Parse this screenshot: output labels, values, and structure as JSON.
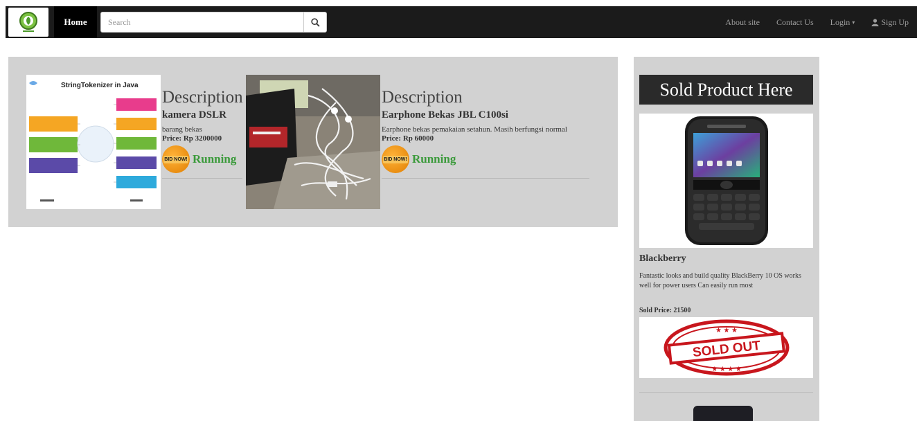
{
  "navbar": {
    "home_label": "Home",
    "search_placeholder": "Search",
    "about_label": "About site",
    "contact_label": "Contact Us",
    "login_label": "Login",
    "signup_label": "Sign Up"
  },
  "products": [
    {
      "image_title": "StringTokenizer in Java",
      "heading": "Description",
      "name": "kamera DSLR",
      "description": "barang bekas",
      "price": "Price: Rp 3200000",
      "bid_label": "BID NOW!",
      "status": "Running"
    },
    {
      "heading": "Description",
      "name": "Earphone Bekas JBL C100si",
      "description": "Earphone bekas pemakaian setahun. Masih berfungsi normal",
      "price": "Price: Rp 60000",
      "bid_label": "BID NOW!",
      "status": "Running"
    }
  ],
  "sidebar": {
    "header": "Sold Product Here",
    "item": {
      "name": "Blackberry",
      "description": "Fantastic looks and build quality BlackBerry 10 OS works well for power users Can easily run most",
      "price": "Sold Price: 21500",
      "stamp_text": "SOLD OUT"
    }
  },
  "colors": {
    "navbar_bg": "#1b1b1b",
    "panel_bg": "#d2d2d2",
    "status_green": "#3a9a3a",
    "badge_orange": "#f29a1a",
    "stamp_red": "#c8161d"
  },
  "icons": [
    "logo-icon",
    "search-icon",
    "user-icon",
    "caret-down-icon",
    "bid-now-icon"
  ]
}
